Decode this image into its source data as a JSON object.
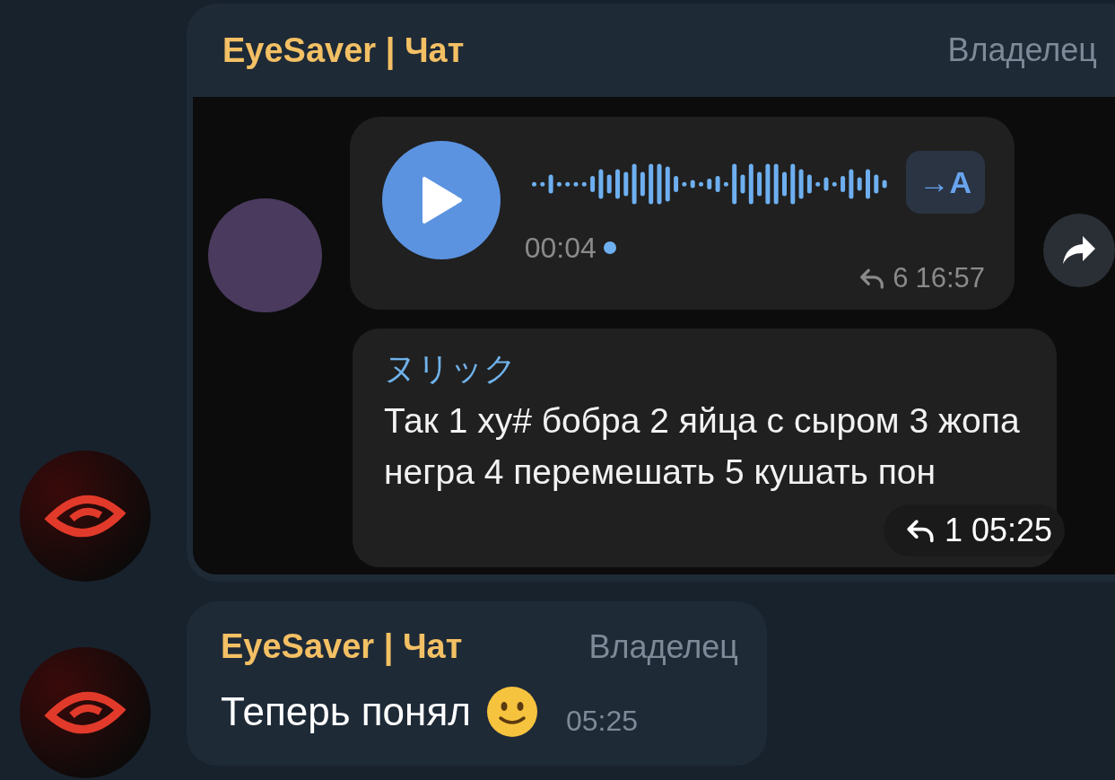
{
  "messages": [
    {
      "kind": "screenshot",
      "sender": "EyeSaver | Чат",
      "role": "Владелец",
      "screenshot": {
        "voice": {
          "translate_label": "→A",
          "duration": "00:04",
          "unread": true,
          "replies": "6",
          "time": "16:57"
        },
        "reply_message": {
          "sender": "ヌリック",
          "text": "Так 1 ху# бобра 2 яйца с сыром 3 жопа негра 4 перемешать 5 кушать пон",
          "replies": "1",
          "time": "05:25"
        }
      }
    },
    {
      "kind": "text",
      "sender": "EyeSaver | Чат",
      "role": "Владелец",
      "text": "Теперь понял",
      "time": "05:25"
    }
  ]
}
